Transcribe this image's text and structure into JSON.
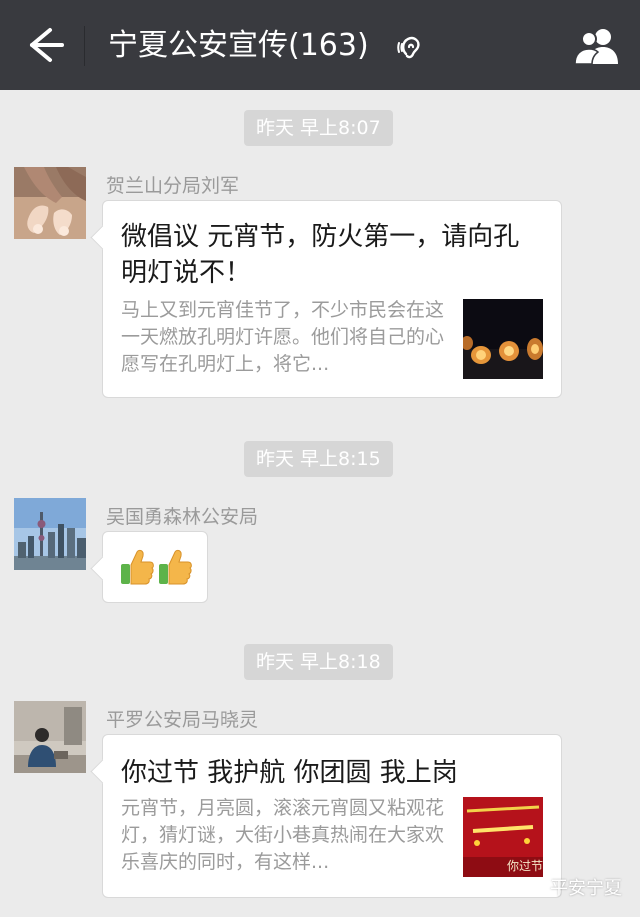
{
  "header": {
    "title": "宁夏公安宣传(163)"
  },
  "messages": [
    {
      "time": "昨天 早上8:07",
      "sender": "贺兰山分局刘军",
      "card_title": "微倡议 元宵节，防火第一，请向孔明灯说不！",
      "card_desc": "马上又到元宵佳节了，不少市民会在这一天燃放孔明灯许愿。他们将自己的心愿写在孔明灯上，将它..."
    },
    {
      "time": "昨天 早上8:15",
      "sender": "吴国勇森林公安局",
      "emoji": "👍👍"
    },
    {
      "time": "昨天 早上8:18",
      "sender": "平罗公安局马晓灵",
      "card_title": "你过节 我护航 你团圆 我上岗",
      "card_desc": "元宵节，月亮圆，滚滚元宵圆又粘观花灯，猜灯谜，大街小巷真热闹在大家欢乐喜庆的同时，有这样...",
      "thumb_caption": "你过节"
    }
  ],
  "watermark": "平安宁夏",
  "colors": {
    "topbar": "#393a3f",
    "background": "#ebebeb",
    "time_pill": "#d6d6d6"
  },
  "icons": [
    "back-arrow-icon",
    "earpiece-icon",
    "group-members-icon"
  ]
}
